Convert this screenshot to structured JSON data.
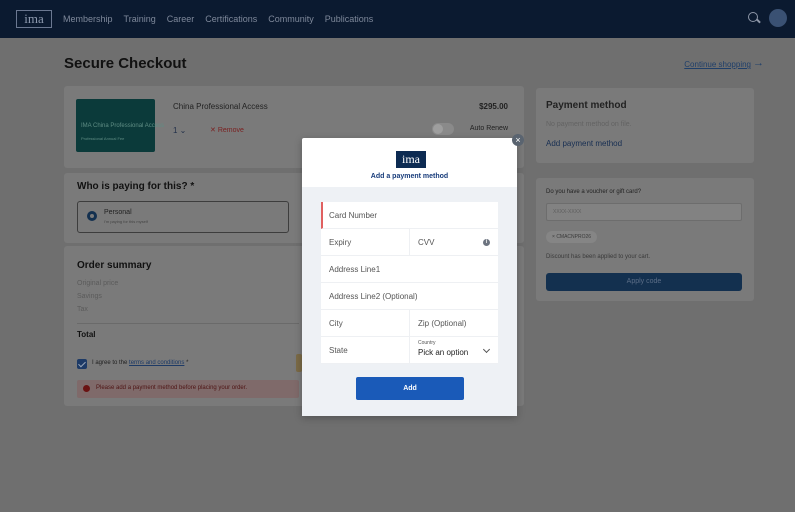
{
  "nav": {
    "logo": "ima",
    "links": [
      "Membership",
      "Training",
      "Career",
      "Certifications",
      "Community",
      "Publications"
    ]
  },
  "page": {
    "title": "Secure Checkout",
    "continue_label": "Continue shopping",
    "continue_arrow": "→"
  },
  "product": {
    "image_caption": "IMA China Professional Access",
    "image_subcaption": "Professional Annual Fee",
    "name": "China Professional Access",
    "price": "$295.00",
    "quantity": "1",
    "remove_label": "Remove",
    "auto_renew_label": "Auto Renew"
  },
  "payer": {
    "title": "Who is paying for this? *",
    "option_label": "Personal",
    "option_desc": "I'm paying for this myself"
  },
  "summary": {
    "title": "Order summary",
    "rows": [
      "Original price",
      "Savings",
      "Tax"
    ],
    "total_label": "Total",
    "agree_prefix": "I agree to the ",
    "agree_link": "terms and conditions",
    "agree_suffix": " *",
    "error_text": "Please add a payment method before placing your order."
  },
  "payment": {
    "title": "Payment method",
    "none_text": "No payment method on file.",
    "add_link": "Add payment method"
  },
  "voucher": {
    "label": "Do you have a voucher or gift card?",
    "placeholder": "XXXX-XXXX",
    "chip": "CMACNPRO26",
    "applied_text": "Discount has been applied to your cart.",
    "apply_label": "Apply code"
  },
  "modal": {
    "logo": "ima",
    "title": "Add a payment method",
    "card_number": "Card Number",
    "expiry": "Expiry",
    "cvv": "CVV",
    "address1": "Address Line1",
    "address2": "Address Line2 (Optional)",
    "city": "City",
    "zip": "Zip (Optional)",
    "state": "State",
    "country_label": "Country",
    "country_value": "Pick an option",
    "add_button": "Add",
    "close": "×"
  },
  "colors": {
    "overlay": "#6f6f6f",
    "brand_navy": "#0d2b52",
    "add_button": "#1a5ab8",
    "error_accent": "#e06060"
  }
}
